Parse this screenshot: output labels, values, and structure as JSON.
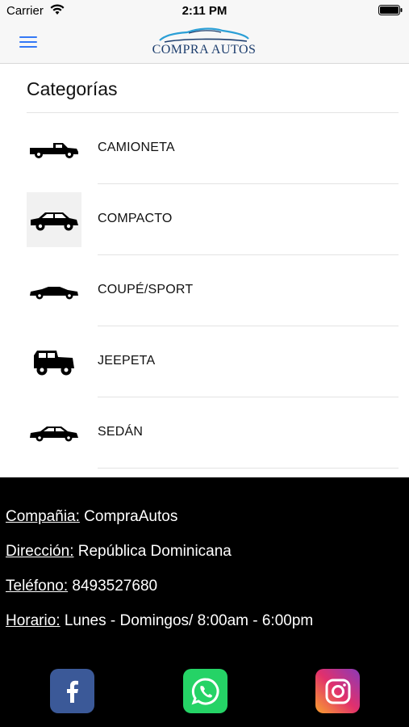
{
  "status_bar": {
    "carrier": "Carrier",
    "time": "2:11 PM"
  },
  "nav": {
    "logo_text": "COMPRA AUTOS",
    "accent_color": "#3478f6"
  },
  "content": {
    "title": "Categorías",
    "categories": [
      {
        "label": "CAMIONETA",
        "icon": "pickup-truck-icon"
      },
      {
        "label": "COMPACTO",
        "icon": "compact-car-icon"
      },
      {
        "label": "COUPÉ/SPORT",
        "icon": "coupe-car-icon"
      },
      {
        "label": "JEEPETA",
        "icon": "jeep-icon"
      },
      {
        "label": "SEDÁN",
        "icon": "sedan-car-icon"
      }
    ]
  },
  "footer": {
    "company_key": "Compañia:",
    "company_value": "CompraAutos",
    "address_key": "Dirección:",
    "address_value": "República Dominicana",
    "phone_key": "Teléfono:",
    "phone_value": "8493527680",
    "hours_key": "Horario:",
    "hours_value": "Lunes - Domingos/ 8:00am - 6:00pm",
    "social": [
      "facebook-icon",
      "whatsapp-icon",
      "instagram-icon"
    ]
  }
}
